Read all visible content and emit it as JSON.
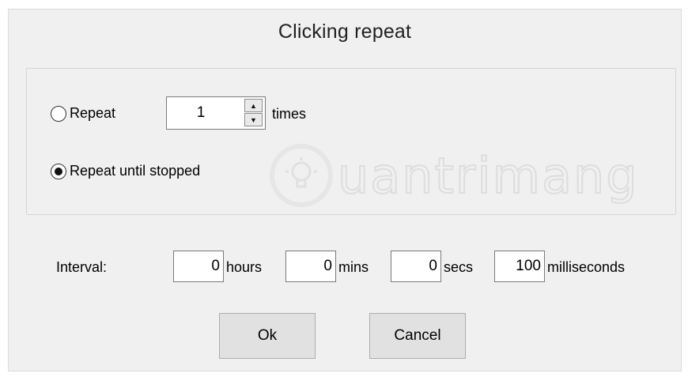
{
  "dialog": {
    "title": "Clicking repeat"
  },
  "repeat_options": {
    "repeat_label": "Repeat",
    "repeat_count": "1",
    "times_label": "times",
    "until_stopped_label": "Repeat until stopped",
    "selected": "until_stopped"
  },
  "interval": {
    "label": "Interval:",
    "hours_value": "0",
    "hours_label": "hours",
    "mins_value": "0",
    "mins_label": "mins",
    "secs_value": "0",
    "secs_label": "secs",
    "ms_value": "100",
    "ms_label": "milliseconds"
  },
  "buttons": {
    "ok_label": "Ok",
    "cancel_label": "Cancel"
  },
  "watermark": {
    "text": "uantrimang"
  },
  "icons": {
    "spin_up": "spin-up-arrow-icon",
    "spin_down": "spin-down-arrow-icon",
    "watermark_logo": "lightbulb-icon"
  }
}
